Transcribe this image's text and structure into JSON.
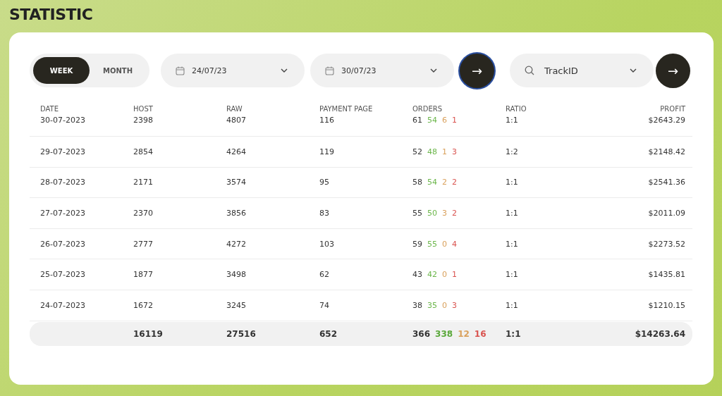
{
  "title": "STATISTIC",
  "period_toggle": [
    {
      "label": "WEEK",
      "selected": true
    },
    {
      "label": "MONTH",
      "selected": false
    }
  ],
  "date_from": {
    "value": "24/07/23"
  },
  "date_to": {
    "value": "30/07/23"
  },
  "apply_button": {
    "label": "→",
    "focused": true
  },
  "search": {
    "value": "TrackID"
  },
  "search_button": {
    "label": "→"
  },
  "table": {
    "columns": [
      "DATE",
      "HOST",
      "RAW",
      "PAYMENT PAGE",
      "ORDERS",
      "RATIO",
      "PROFIT"
    ],
    "rows": [
      {
        "date": "30-07-2023",
        "host": "2398",
        "raw": "4807",
        "payment_page": "116",
        "orders": [
          {
            "value": "61",
            "color": "#333333"
          },
          {
            "value": "54",
            "color": "#6bb64a"
          },
          {
            "value": "6",
            "color": "#d9a05b"
          },
          {
            "value": "1",
            "color": "#d9534f"
          }
        ],
        "ratio": "1:1",
        "profit": "$2643.29"
      },
      {
        "date": "29-07-2023",
        "host": "2854",
        "raw": "4264",
        "payment_page": "119",
        "orders": [
          {
            "value": "52",
            "color": "#333333"
          },
          {
            "value": "48",
            "color": "#6bb64a"
          },
          {
            "value": "1",
            "color": "#d9a05b"
          },
          {
            "value": "3",
            "color": "#d9534f"
          }
        ],
        "ratio": "1:2",
        "profit": "$2148.42"
      },
      {
        "date": "28-07-2023",
        "host": "2171",
        "raw": "3574",
        "payment_page": "95",
        "orders": [
          {
            "value": "58",
            "color": "#333333"
          },
          {
            "value": "54",
            "color": "#6bb64a"
          },
          {
            "value": "2",
            "color": "#d9a05b"
          },
          {
            "value": "2",
            "color": "#d9534f"
          }
        ],
        "ratio": "1:1",
        "profit": "$2541.36"
      },
      {
        "date": "27-07-2023",
        "host": "2370",
        "raw": "3856",
        "payment_page": "83",
        "orders": [
          {
            "value": "55",
            "color": "#333333"
          },
          {
            "value": "50",
            "color": "#6bb64a"
          },
          {
            "value": "3",
            "color": "#d9a05b"
          },
          {
            "value": "2",
            "color": "#d9534f"
          }
        ],
        "ratio": "1:1",
        "profit": "$2011.09"
      },
      {
        "date": "26-07-2023",
        "host": "2777",
        "raw": "4272",
        "payment_page": "103",
        "orders": [
          {
            "value": "59",
            "color": "#333333"
          },
          {
            "value": "55",
            "color": "#6bb64a"
          },
          {
            "value": "0",
            "color": "#d9a05b"
          },
          {
            "value": "4",
            "color": "#d9534f"
          }
        ],
        "ratio": "1:1",
        "profit": "$2273.52"
      },
      {
        "date": "25-07-2023",
        "host": "1877",
        "raw": "3498",
        "payment_page": "62",
        "orders": [
          {
            "value": "43",
            "color": "#333333"
          },
          {
            "value": "42",
            "color": "#6bb64a"
          },
          {
            "value": "0",
            "color": "#d9a05b"
          },
          {
            "value": "1",
            "color": "#d9534f"
          }
        ],
        "ratio": "1:1",
        "profit": "$1435.81"
      },
      {
        "date": "24-07-2023",
        "host": "1672",
        "raw": "3245",
        "payment_page": "74",
        "orders": [
          {
            "value": "38",
            "color": "#333333"
          },
          {
            "value": "35",
            "color": "#6bb64a"
          },
          {
            "value": "0",
            "color": "#d9a05b"
          },
          {
            "value": "3",
            "color": "#d9534f"
          }
        ],
        "ratio": "1:1",
        "profit": "$1210.15"
      }
    ],
    "total": {
      "host": "16119",
      "raw": "27516",
      "payment_page": "652",
      "orders": [
        {
          "value": "366",
          "color": "#333333"
        },
        {
          "value": "338",
          "color": "#5aa83a"
        },
        {
          "value": "12",
          "color": "#d9a05b"
        },
        {
          "value": "16",
          "color": "#d9534f"
        }
      ],
      "ratio": "1:1",
      "profit": "$14263.64"
    }
  }
}
